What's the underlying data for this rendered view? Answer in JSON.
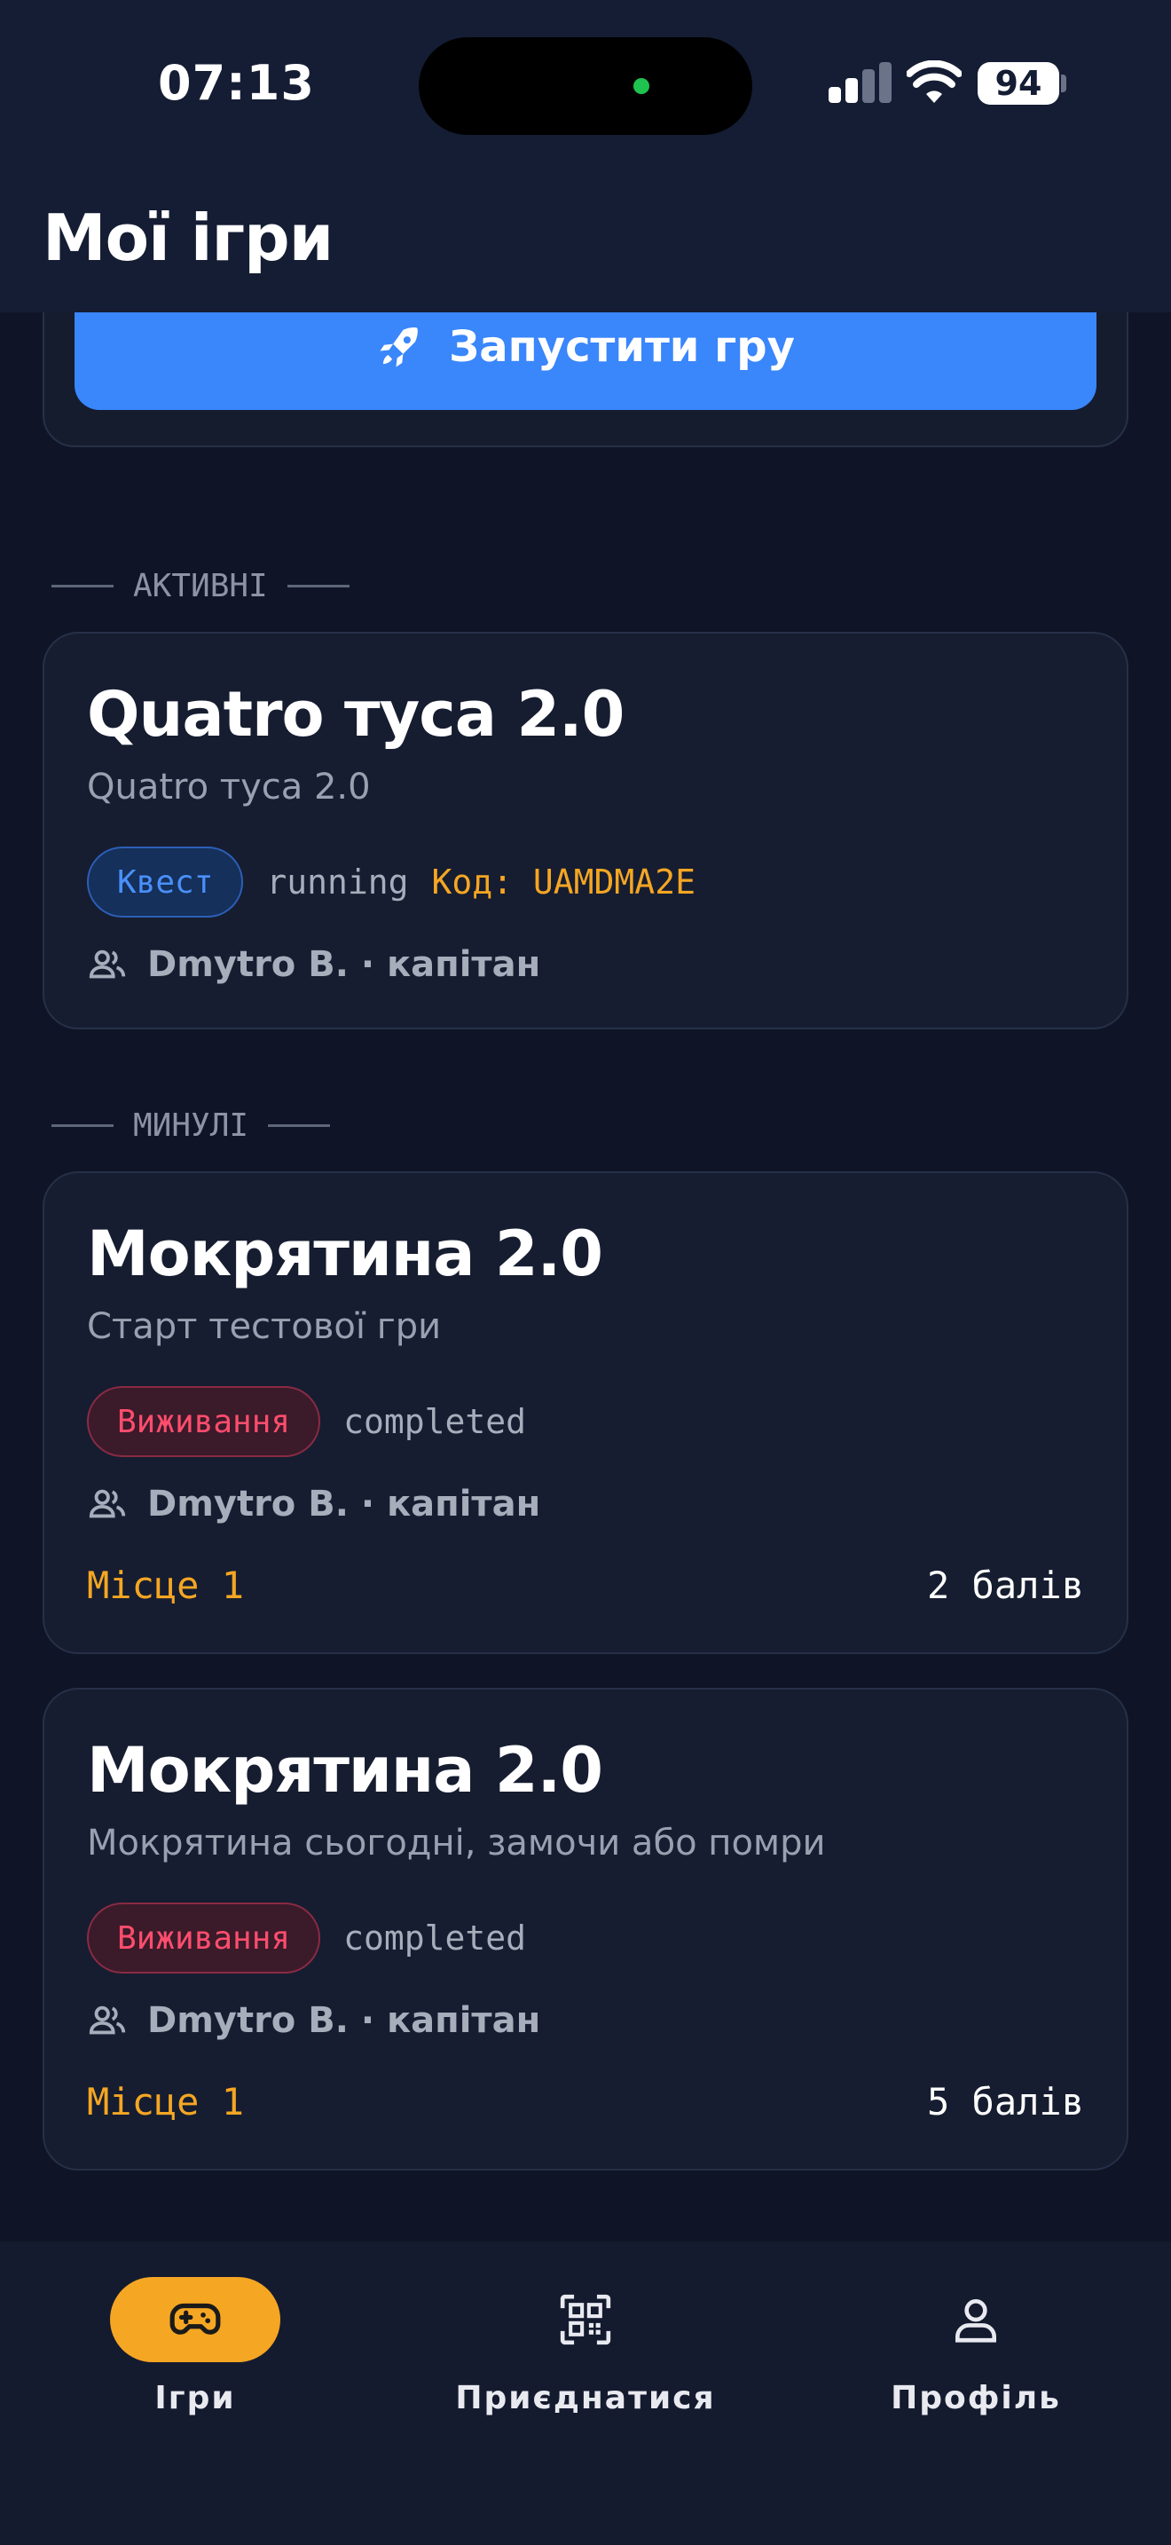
{
  "status_bar": {
    "time": "07:13",
    "battery": "94"
  },
  "header": {
    "title": "Мої ігри"
  },
  "launch": {
    "label": "Запустити гру"
  },
  "sections": {
    "active": "АКТИВНІ",
    "past": "МИНУЛІ"
  },
  "active_games": [
    {
      "title": "Quatro туса 2.0",
      "subtitle": "Quatro туса 2.0",
      "type": "Квест",
      "status": "running",
      "code": "Код: UAMDMA2E",
      "team": "Dmytro B. · капітан"
    }
  ],
  "past_games": [
    {
      "title": "Мокрятина 2.0",
      "subtitle": "Старт тестової гри",
      "type": "Виживання",
      "status": "completed",
      "team": "Dmytro B. · капітан",
      "place": "Місце 1",
      "score": "2 балів"
    },
    {
      "title": "Мокрятина 2.0",
      "subtitle": "Мокрятина сьогодні, замочи або помри",
      "type": "Виживання",
      "status": "completed",
      "team": "Dmytro B. · капітан",
      "place": "Місце 1",
      "score": "5 балів"
    }
  ],
  "nav": {
    "games": "Ігри",
    "join": "Приєднатися",
    "profile": "Профіль"
  },
  "colors": {
    "accent_blue": "#3a86fb",
    "accent_orange": "#f5a623",
    "danger": "#ff4d6d",
    "background": "#0f1526"
  }
}
